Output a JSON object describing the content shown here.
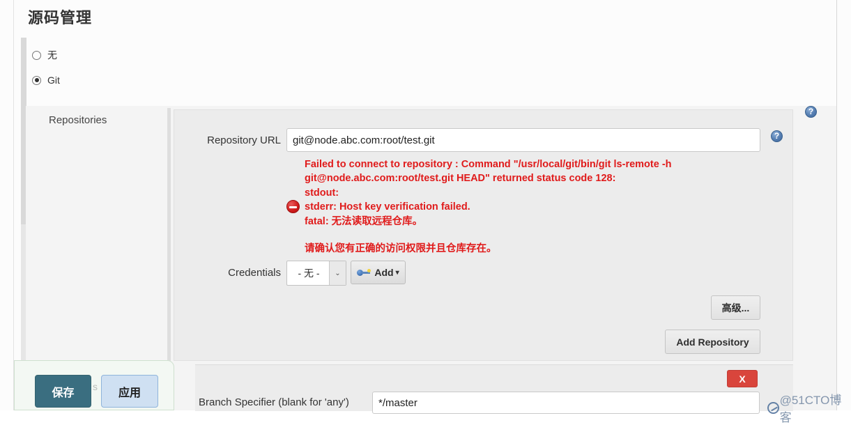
{
  "page": {
    "title": "源码管理"
  },
  "scm_options": [
    {
      "label": "无",
      "selected": false,
      "name": "none"
    },
    {
      "label": "Git",
      "selected": true,
      "name": "git"
    }
  ],
  "section": {
    "name": "Repositories"
  },
  "repository": {
    "url_label": "Repository URL",
    "url_value": "git@node.abc.com:root/test.git",
    "url_placeholder": "",
    "credentials_label": "Credentials",
    "credentials_value": "- 无 -",
    "add_credentials_label": "Add",
    "add_credentials_caret": "▾",
    "advanced_label": "高级...",
    "add_repository_label": "Add Repository",
    "remove_label": "X"
  },
  "error": {
    "message": "Failed to connect to repository : Command \"/usr/local/git/bin/git ls-remote -h git@node.abc.com:root/test.git HEAD\" returned status code 128:\nstdout:\nstderr: Host key verification failed.\nfatal: 无法读取远程仓库。",
    "hint": "请确认您有正确的访问权限并且仓库存在。"
  },
  "branches": {
    "specifier_label": "Branch Specifier (blank for 'any')",
    "specifier_value": "*/master",
    "occluded_label": "s"
  },
  "footer": {
    "save_label": "保存",
    "apply_label": "应用"
  },
  "watermark": {
    "text": "@51CTO博客"
  },
  "icons": {
    "help": "?",
    "chevron_down": "⌄",
    "error": "error-circle-icon",
    "key": "key-icon"
  },
  "colors": {
    "error_red": "#e01b1b",
    "save_teal": "#3a6e80",
    "apply_blue": "#cfe0f2",
    "remove_red": "#d9453c",
    "help_blue": "#3c659c"
  }
}
